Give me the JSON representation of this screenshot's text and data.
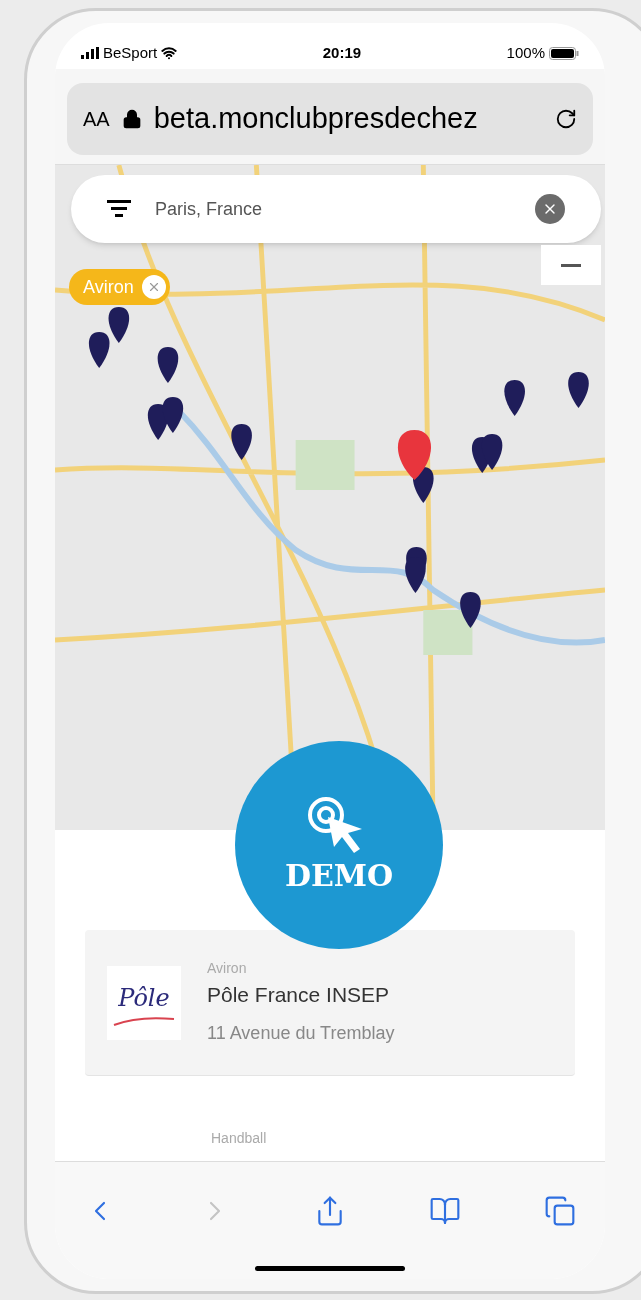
{
  "status_bar": {
    "carrier": "BeSport",
    "time": "20:19",
    "battery": "100%"
  },
  "browser": {
    "text_size_button": "AA",
    "url": "beta.monclubpresdechez"
  },
  "search": {
    "value": "Paris, France"
  },
  "filter_chip": {
    "label": "Aviron"
  },
  "demo_badge": {
    "label": "DEMO"
  },
  "results": [
    {
      "sport": "Aviron",
      "name": "Pôle France INSEP",
      "address": "11 Avenue du Tremblay",
      "logo_text": "Pôle"
    }
  ],
  "next_result": {
    "sport": "Handball"
  },
  "toolbar": [
    {
      "kind": "back",
      "disabled": false
    },
    {
      "kind": "forward",
      "disabled": true
    },
    {
      "kind": "share",
      "disabled": false
    },
    {
      "kind": "bookmarks",
      "disabled": false
    },
    {
      "kind": "tabs",
      "disabled": false
    }
  ]
}
